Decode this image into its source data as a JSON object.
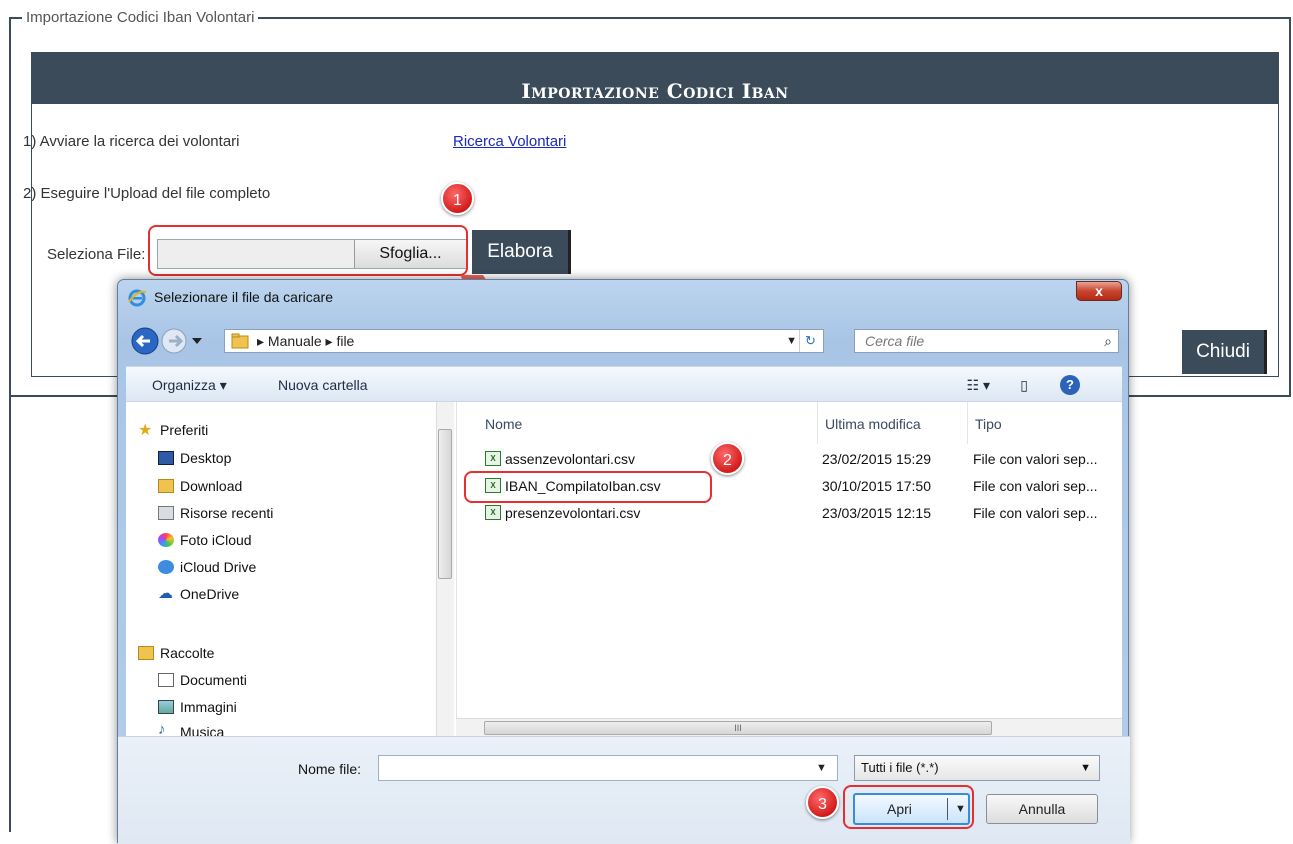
{
  "page": {
    "legend": "Importazione Codici Iban Volontari",
    "header": "Importazione Codici Iban",
    "step1": "1) Avviare la ricerca dei volontari",
    "search_link": "Ricerca Volontari",
    "step2": "2) Eseguire l'Upload del file completo",
    "select_label": "Seleziona File:",
    "browse_button": "Sfoglia...",
    "process_button": "Elabora",
    "close_button": "Chiudi"
  },
  "markers": [
    "1",
    "2",
    "3"
  ],
  "dialog": {
    "title": "Selezionare il file da caricare",
    "breadcrumb": [
      "Manuale",
      "file"
    ],
    "search_placeholder": "Cerca file",
    "toolbar": {
      "organize": "Organizza ▾",
      "new_folder": "Nuova cartella"
    },
    "nav": {
      "favorites": "Preferiti",
      "favorites_items": [
        "Desktop",
        "Download",
        "Risorse recenti",
        "Foto iCloud",
        "iCloud Drive",
        "OneDrive"
      ],
      "libraries": "Raccolte",
      "libraries_items": [
        "Documenti",
        "Immagini",
        "Musica"
      ]
    },
    "columns": {
      "name": "Nome",
      "modified": "Ultima modifica",
      "type": "Tipo"
    },
    "files": [
      {
        "name": "assenzevolontari.csv",
        "modified": "23/02/2015 15:29",
        "type": "File con valori sep..."
      },
      {
        "name": "IBAN_CompilatoIban.csv",
        "modified": "30/10/2015 17:50",
        "type": "File con valori sep..."
      },
      {
        "name": "presenzevolontari.csv",
        "modified": "23/03/2015 12:15",
        "type": "File con valori sep..."
      }
    ],
    "filename_label": "Nome file:",
    "filename_value": "",
    "filetype": "Tutti i file (*.*)",
    "open_button": "Apri",
    "cancel_button": "Annulla",
    "close_glyph": "x",
    "scroll_glyph": "III"
  },
  "colors": {
    "panel": "#3b4b5a",
    "highlight": "#e53030",
    "link": "#1a2bbf"
  }
}
